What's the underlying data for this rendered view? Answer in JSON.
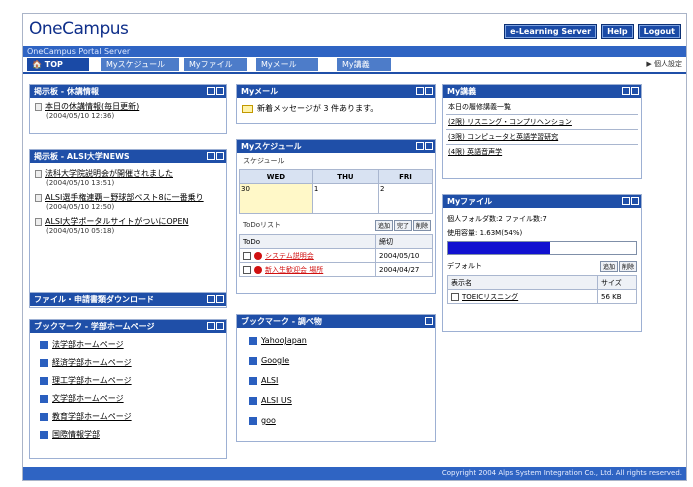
{
  "header": {
    "logo": "OneCampus",
    "buttons": [
      "e-Learning Server",
      "Help",
      "Logout"
    ],
    "portal": "OneCampus Portal Server",
    "settings": "▶ 個人設定"
  },
  "tabs": [
    "🏠 TOP",
    "Myスケジュール",
    "Myファイル",
    "Myメール",
    "My講義"
  ],
  "bulletin_closed": {
    "title": "掲示板 - 休講情報",
    "items": [
      {
        "text": "本日の休講情報(毎日更新)",
        "date": "(2004/05/10 12:36)"
      }
    ]
  },
  "bulletin_news": {
    "title": "掲示板 - ALSI大学NEWS",
    "items": [
      {
        "text": "法科大学院説明会が開催されました",
        "date": "(2004/05/10 13:51)"
      },
      {
        "text": "ALSI選手権連覇－野球部ベスト8に一番乗り",
        "date": "(2004/05/10 12:50)"
      },
      {
        "text": "ALSI大学ポータルサイトがついにOPEN",
        "date": "(2004/05/10 05:18)"
      }
    ]
  },
  "download": {
    "title": "ファイル・申請書類ダウンロード"
  },
  "bookmarks_dept": {
    "title": "ブックマーク - 学部ホームページ",
    "items": [
      "法学部ホームページ",
      "経済学部ホームページ",
      "理工学部ホームページ",
      "文学部ホームページ",
      "教育学部ホームページ",
      "国際情報学部"
    ]
  },
  "mail": {
    "title": "Myメール",
    "message": "新着メッセージが 3 件あります。"
  },
  "schedule": {
    "title": "Myスケジュール",
    "section": "スケジュール",
    "days": [
      {
        "name": "WED",
        "num": "30"
      },
      {
        "name": "THU",
        "num": "1"
      },
      {
        "name": "FRI",
        "num": "2"
      }
    ],
    "todo_label": "ToDoリスト",
    "todo_buttons": [
      "追加",
      "完了",
      "削除"
    ],
    "todo_headers": [
      "ToDo",
      "締切"
    ],
    "todos": [
      {
        "task": "システム説明会",
        "deadline": "2004/05/10"
      },
      {
        "task": "新入生歓迎会 場所",
        "deadline": "2004/04/27"
      }
    ]
  },
  "bookmarks_research": {
    "title": "ブックマーク - 調べ物",
    "items": [
      "YahooJapan",
      "Google",
      "ALSI",
      "ALSI US",
      "goo"
    ]
  },
  "lectures": {
    "title": "My講義",
    "heading": "本日の履修講義一覧",
    "items": [
      "(2限) リスニング・コンプリヘンション",
      "(3限) コンピュータと英語学習研究",
      "(4限) 英語音声学"
    ]
  },
  "files": {
    "title": "Myファイル",
    "stats": "個人フォルダ数:2 ファイル数:7",
    "usage": "使用容量: 1.63M(54%)",
    "usage_fraction": 0.54,
    "folder": "デフォルト",
    "buttons": [
      "追加",
      "削除"
    ],
    "headers": [
      "表示名",
      "サイズ"
    ],
    "rows": [
      {
        "name": "TOEICリスニング",
        "size": "56 KB"
      }
    ]
  },
  "footer": "Copyright 2004 Alps System Integration Co., Ltd. All rights reserved."
}
